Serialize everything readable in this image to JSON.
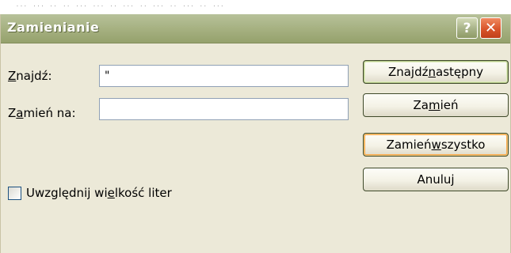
{
  "background_strip": {
    "text": ", ᵢᵢᵢ ᵢᵢᵢ ᵢᵢ ᵢᵢ ᵢᵢᵢ ᵢᵢᵢ ᵢᵢ ᵢᵢᵢ ᵢᵢ ᵢᵢᵢ ᵢᵢ ᵢᵢᵢ ᵢᵢ ᵢᵢᵢ"
  },
  "dialog": {
    "title": "Zamienianie",
    "help_glyph": "?",
    "close_glyph": "✕"
  },
  "find": {
    "label_underlined": "Z",
    "label_rest": "najdź:",
    "value": "\""
  },
  "replace": {
    "label_pre": "Z",
    "label_underlined": "a",
    "label_rest": "mień na:",
    "value": ""
  },
  "buttons": {
    "find_next_pre": "Znajdź ",
    "find_next_underlined": "n",
    "find_next_rest": "astępny",
    "replace_pre": "Za",
    "replace_underlined": "m",
    "replace_rest": "ień",
    "replace_all_pre": "Zamień ",
    "replace_all_underlined": "w",
    "replace_all_rest": "szystko",
    "cancel": "Anuluj"
  },
  "match_case": {
    "checked": false,
    "label_pre": "Uwzględnij wi",
    "label_underlined": "e",
    "label_rest": "lkość liter"
  },
  "colors": {
    "titlebar": "#A8B384",
    "face": "#ECE9D8",
    "close": "#D9552B"
  }
}
